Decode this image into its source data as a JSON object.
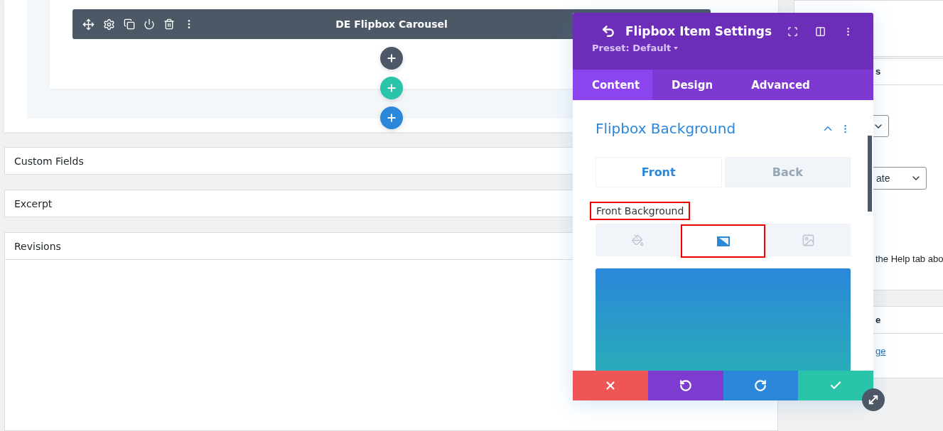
{
  "builder": {
    "module_bar": {
      "title": "DE Flipbox Carousel"
    },
    "add_buttons": [
      {
        "color": "#4c5866"
      },
      {
        "color": "#29c4a9"
      },
      {
        "color": "#2b87da"
      }
    ]
  },
  "panels": [
    {
      "title": "Custom Fields",
      "expanded": false
    },
    {
      "title": "Excerpt",
      "expanded": false
    },
    {
      "title": "Revisions",
      "expanded": true
    }
  ],
  "sidebar": {
    "header_fragment": "s",
    "select_fragment": "ate",
    "help_fragment": "the Help tab abo",
    "header_fragment_2": "e",
    "link_fragment": "ge"
  },
  "modal": {
    "title": "Flipbox Item Settings",
    "preset": "Preset: Default",
    "tabs": [
      {
        "label": "Content",
        "selected": true
      },
      {
        "label": "Design",
        "selected": false
      },
      {
        "label": "Advanced",
        "selected": false
      }
    ],
    "section": {
      "title": "Flipbox Background",
      "expanded": true
    },
    "side_toggle": [
      {
        "label": "Front",
        "selected": true
      },
      {
        "label": "Back",
        "selected": false
      }
    ],
    "field_label": {
      "text": "Front Background",
      "highlighted": true
    },
    "background_types": [
      {
        "kind": "color",
        "selected": false,
        "highlighted": false
      },
      {
        "kind": "gradient",
        "selected": true,
        "highlighted": true
      },
      {
        "kind": "image",
        "selected": false,
        "highlighted": false
      }
    ],
    "footer_buttons": [
      {
        "kind": "discard"
      },
      {
        "kind": "undo"
      },
      {
        "kind": "redo"
      },
      {
        "kind": "save"
      }
    ]
  }
}
